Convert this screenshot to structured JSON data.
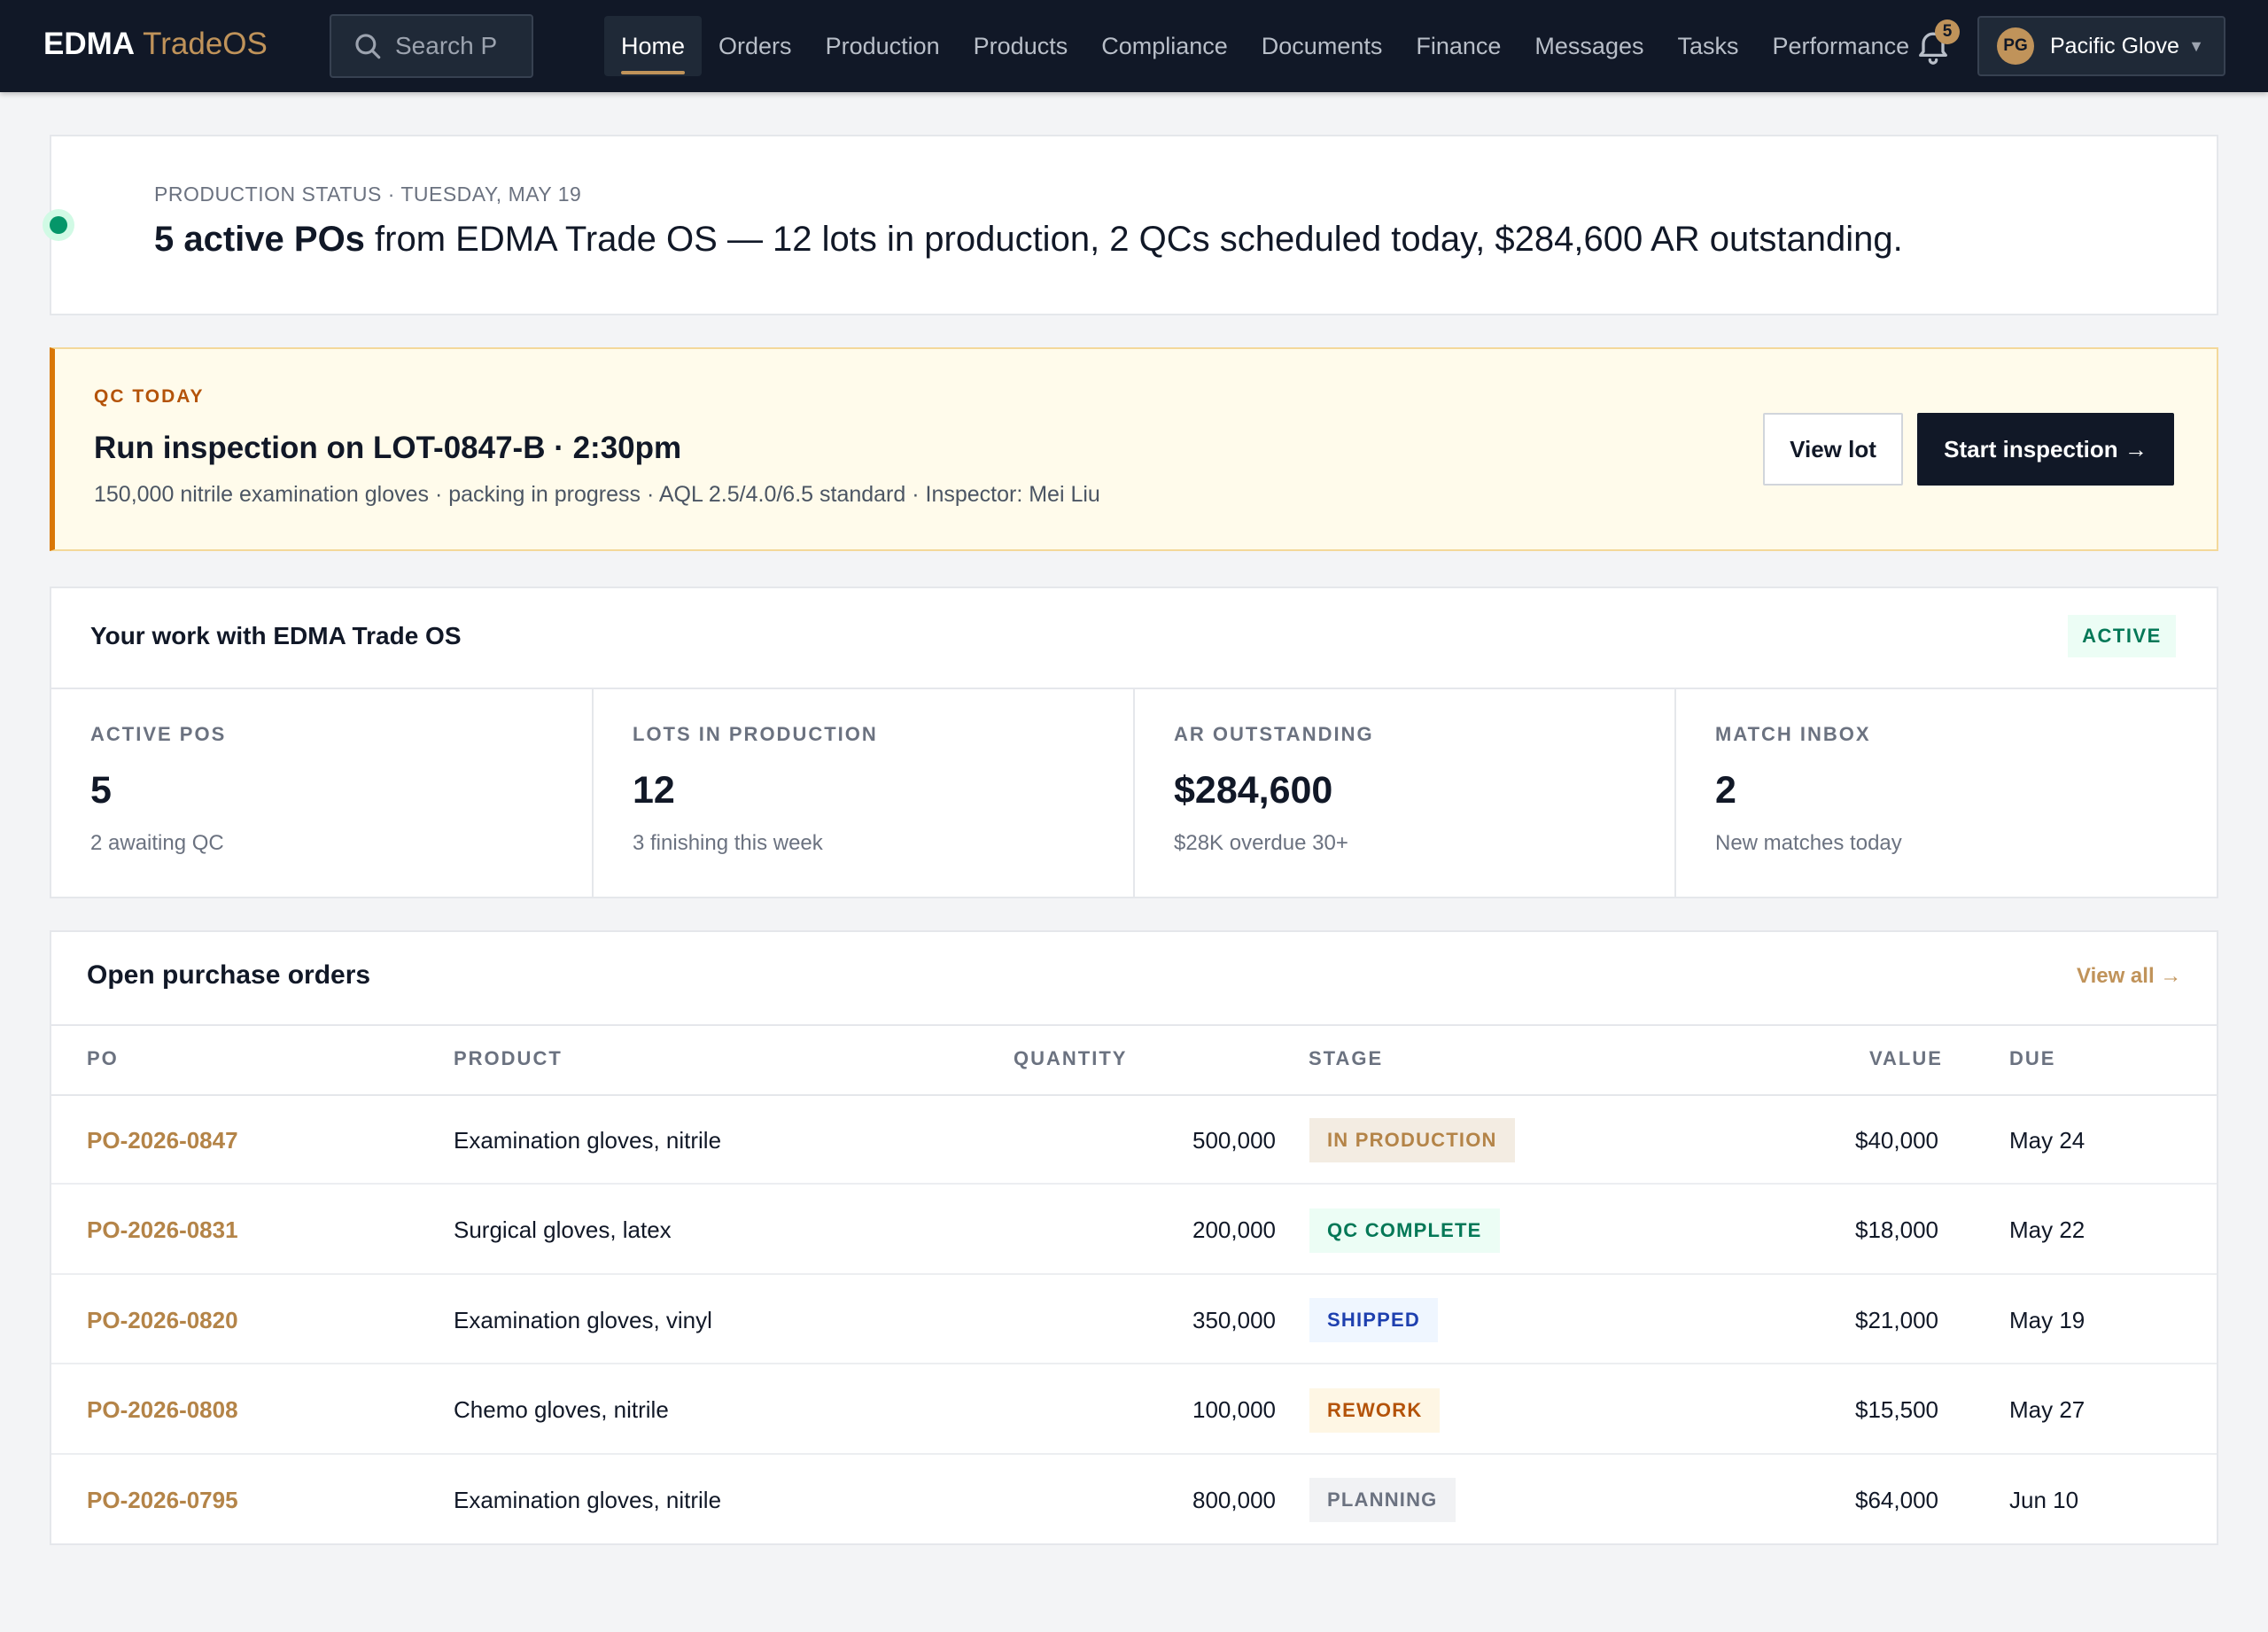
{
  "header": {
    "brand_primary": "EDMA",
    "brand_secondary": "TradeOS",
    "search_placeholder": "Search P",
    "nav": [
      {
        "label": "Home",
        "active": true
      },
      {
        "label": "Orders"
      },
      {
        "label": "Production"
      },
      {
        "label": "Products"
      },
      {
        "label": "Compliance"
      },
      {
        "label": "Documents"
      },
      {
        "label": "Finance"
      },
      {
        "label": "Messages"
      },
      {
        "label": "Tasks"
      },
      {
        "label": "Performance"
      }
    ],
    "notifications_count": "5",
    "account_initials": "PG",
    "account_name": "Pacific Glove",
    "icons": {
      "search": "search-icon",
      "bell": "bell-icon",
      "caret": "chevron-down-icon"
    }
  },
  "status": {
    "eyebrow": "PRODUCTION STATUS · TUESDAY, MAY 19",
    "headline_bold": "5 active POs",
    "headline_rest": " from EDMA Trade OS — 12 lots in production, 2 QCs scheduled today, $284,600 AR outstanding."
  },
  "qc": {
    "eyebrow": "QC TODAY",
    "title": "Run inspection on LOT-0847-B · 2:30pm",
    "subtitle": "150,000 nitrile examination gloves · packing in progress · AQL 2.5/4.0/6.5 standard · Inspector: Mei Liu",
    "view_lot_label": "View lot",
    "start_label": "Start inspection →"
  },
  "work": {
    "title": "Your work with EDMA Trade OS",
    "badge": "ACTIVE",
    "stats": [
      {
        "label": "ACTIVE POS",
        "value": "5",
        "note": "2 awaiting QC"
      },
      {
        "label": "LOTS IN PRODUCTION",
        "value": "12",
        "note": "3 finishing this week"
      },
      {
        "label": "AR OUTSTANDING",
        "value": "$284,600",
        "note": "$28K overdue 30+"
      },
      {
        "label": "MATCH INBOX",
        "value": "2",
        "note": "New matches today"
      }
    ]
  },
  "orders": {
    "title": "Open purchase orders",
    "view_all_label": "View all →",
    "columns": {
      "po": "PO",
      "product": "PRODUCT",
      "quantity": "QUANTITY",
      "stage": "STAGE",
      "value": "VALUE",
      "due": "DUE"
    },
    "rows": [
      {
        "po": "PO-2026-0847",
        "product": "Examination gloves, nitrile",
        "quantity": "500,000",
        "stage": "IN PRODUCTION",
        "stage_bg": "#f3ece2",
        "stage_fg": "#b48448",
        "value": "$40,000",
        "due": "May 24"
      },
      {
        "po": "PO-2026-0831",
        "product": "Surgical gloves, latex",
        "quantity": "200,000",
        "stage": "QC COMPLETE",
        "stage_bg": "#ecfdf5",
        "stage_fg": "#047857",
        "value": "$18,000",
        "due": "May 22"
      },
      {
        "po": "PO-2026-0820",
        "product": "Examination gloves, vinyl",
        "quantity": "350,000",
        "stage": "SHIPPED",
        "stage_bg": "#eff6ff",
        "stage_fg": "#1e40af",
        "value": "$21,000",
        "due": "May 19"
      },
      {
        "po": "PO-2026-0808",
        "product": "Chemo gloves, nitrile",
        "quantity": "100,000",
        "stage": "REWORK",
        "stage_bg": "#fef6e4",
        "stage_fg": "#b45309",
        "value": "$15,500",
        "due": "May 27"
      },
      {
        "po": "PO-2026-0795",
        "product": "Examination gloves, nitrile",
        "quantity": "800,000",
        "stage": "PLANNING",
        "stage_bg": "#f1f2f4",
        "stage_fg": "#6b7280",
        "value": "$64,000",
        "due": "Jun 10"
      }
    ]
  },
  "colors": {
    "nav_bg": "#111827",
    "accent": "#c0935a",
    "success": "#059669",
    "warning": "#d97706"
  }
}
